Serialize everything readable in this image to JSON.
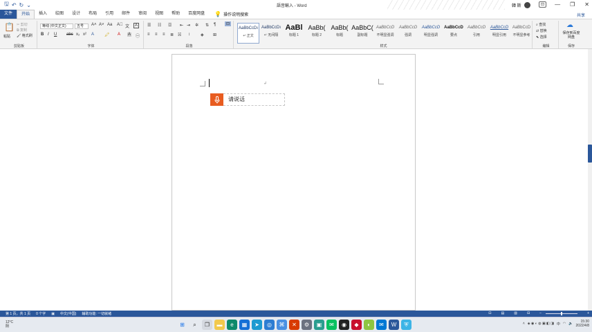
{
  "window": {
    "title": "語音輸入 - Word",
    "user": "韓 斯",
    "ribbon_options": "⊡",
    "controls": [
      "—",
      "❐",
      "✕"
    ]
  },
  "tabs": [
    {
      "label": "文件"
    },
    {
      "label": "开始"
    },
    {
      "label": "插入"
    },
    {
      "label": "绘图"
    },
    {
      "label": "设计"
    },
    {
      "label": "布局"
    },
    {
      "label": "引用"
    },
    {
      "label": "邮件"
    },
    {
      "label": "审阅"
    },
    {
      "label": "视图"
    },
    {
      "label": "帮助"
    },
    {
      "label": "百度网盘"
    }
  ],
  "tell_me": "操作说明搜索",
  "share": "共享",
  "ribbon": {
    "clipboard": {
      "label": "剪贴板",
      "paste": "粘贴",
      "cut": "剪切",
      "copy": "复制",
      "format_painter": "格式刷"
    },
    "font": {
      "label": "字体",
      "font_name": "等线 (中文正文)",
      "font_size": "五号"
    },
    "paragraph": {
      "label": "段落"
    },
    "styles": {
      "label": "样式",
      "items": [
        {
          "sample": "AaBbCcDı",
          "name": "↵ 正文"
        },
        {
          "sample": "AaBbCcDı",
          "name": "↵ 无间隔"
        },
        {
          "sample": "AaBl",
          "name": "标题 1"
        },
        {
          "sample": "AaBb(",
          "name": "标题 2"
        },
        {
          "sample": "AaBb(",
          "name": "标题"
        },
        {
          "sample": "AaBbC(",
          "name": "副标题"
        },
        {
          "sample": "AaBbCcD",
          "name": "不明显强调"
        },
        {
          "sample": "AaBbCcD",
          "name": "强调"
        },
        {
          "sample": "AaBbCcD",
          "name": "明显强调"
        },
        {
          "sample": "AaBbCcD",
          "name": "要点"
        },
        {
          "sample": "AaBbCcD",
          "name": "引用"
        },
        {
          "sample": "AaBbCcD",
          "name": "明显引用"
        },
        {
          "sample": "AaBbCcD",
          "name": "不明显参考"
        }
      ]
    },
    "editing": {
      "label": "编辑",
      "find": "查找",
      "replace": "替换",
      "select": "选择"
    },
    "save": {
      "label": "保存",
      "button": "保存到百度网盘"
    }
  },
  "document": {
    "paragraph_mark": "↲",
    "dictation_label": "请说话"
  },
  "statusbar": {
    "page": "第 1 页，共 1 页",
    "words": "0 个字",
    "language": "中文(中国)",
    "accessibility": "辅助功能: 一切就绪"
  },
  "taskbar": {
    "weather_temp": "12°C",
    "weather_desc": "阴",
    "time": "15:30",
    "date": "2022/4/8"
  },
  "colors": {
    "word_blue": "#2b579a",
    "dictate_orange": "#e85c20"
  }
}
